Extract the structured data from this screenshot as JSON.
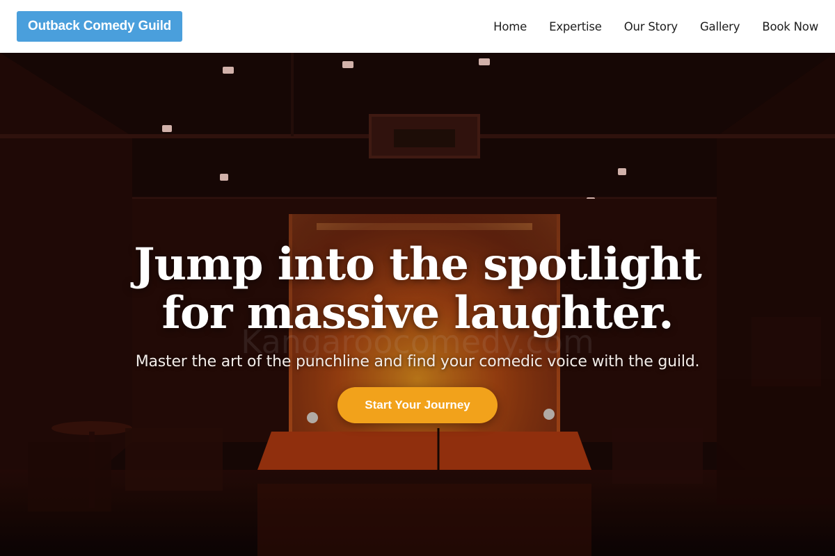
{
  "header": {
    "brand": "Outback Comedy Guild",
    "nav": [
      {
        "label": "Home"
      },
      {
        "label": "Expertise"
      },
      {
        "label": "Our Story"
      },
      {
        "label": "Gallery"
      },
      {
        "label": "Book Now"
      }
    ]
  },
  "hero": {
    "title_line1": "Jump into the spotlight",
    "title_line2": "for massive laughter.",
    "subtitle": "Master the art of the punchline and find your comedic voice with the guild.",
    "cta_label": "Start Your Journey",
    "watermark": "Kangaroocomedy.com"
  },
  "colors": {
    "brand_bg": "#4a9fdc",
    "cta_bg": "#f2a21b",
    "nav_bg": "#ffffff"
  }
}
